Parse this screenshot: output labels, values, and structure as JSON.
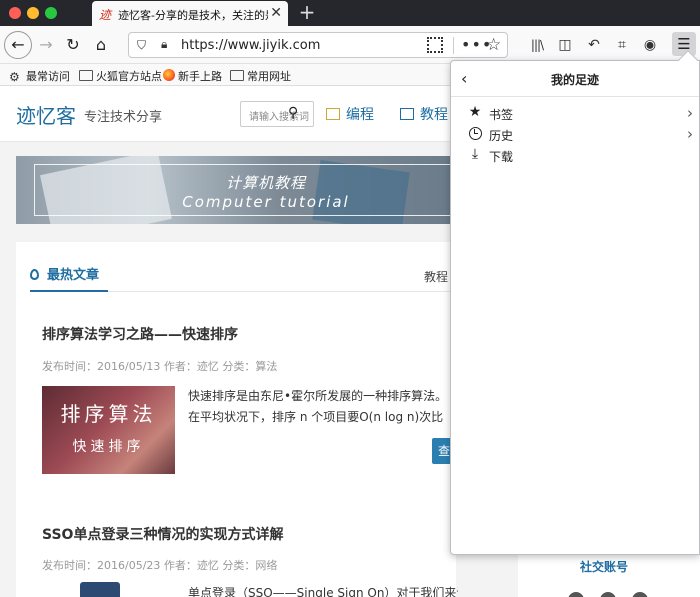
{
  "browser": {
    "tab": {
      "title": "迹忆客-分享的是技术，关注的是成长",
      "favicon": "迹",
      "close": "✕"
    },
    "new_tab": "+",
    "nav": {
      "back": "←",
      "forward": "→",
      "reload": "↻",
      "home": "⌂"
    },
    "url": "https://www.jiyik.com",
    "url_actions": {
      "more": "•••",
      "bookmark": "☆"
    },
    "toolbar_icons": {
      "library": "|||\\",
      "sidebar": "◫",
      "undo": "↶",
      "crop": "⌗",
      "account": "◉",
      "menu": "☰"
    },
    "bookmarks": [
      {
        "label": "最常访问",
        "icon": "gear-icon"
      },
      {
        "label": "火狐官方站点",
        "icon": "folder-icon"
      },
      {
        "label": "新手上路",
        "icon": "firefox-icon"
      },
      {
        "label": "常用网址",
        "icon": "folder-icon"
      }
    ]
  },
  "site": {
    "logo": "迹忆客",
    "slogan": "专注技术分享",
    "search_placeholder": "请输入搜索词",
    "nav": [
      "编程",
      "教程"
    ],
    "banner": {
      "cn": "计算机教程",
      "en": "Computer tutorial"
    },
    "tabs": {
      "hot": "最热文章",
      "tutorial": "教程"
    },
    "articles": [
      {
        "title": "排序算法学习之路——快速排序",
        "meta": "发布时间：2016/05/13 作者：迹忆 分类：算法",
        "thumb_line1": "排序算法",
        "thumb_line2": "快速排序",
        "excerpt": "快速排序是由东尼•霍尔所发展的一种排序算法。在平均状况下，排序 n 个项目要O(n log n)次比较。在最坏",
        "read_more": "查看"
      },
      {
        "title": "SSO单点登录三种情况的实现方式详解",
        "meta": "发布时间：2016/05/23 作者：迹忆 分类：网络",
        "excerpt": "单点登录（SSO——Single Sign On）对于我们来说已经"
      }
    ],
    "sidebar": {
      "social_title": "社交账号"
    }
  },
  "panel": {
    "back": "‹",
    "title": "我的足迹",
    "items": [
      {
        "label": "书签",
        "icon": "star-icon",
        "has_submenu": true
      },
      {
        "label": "历史",
        "icon": "clock-icon",
        "has_submenu": true
      },
      {
        "label": "下载",
        "icon": "download-icon",
        "has_submenu": false
      }
    ],
    "submenu_arrow": "›"
  },
  "colors": {
    "accent": "#1f6da1",
    "tabbar": "#26262d"
  }
}
